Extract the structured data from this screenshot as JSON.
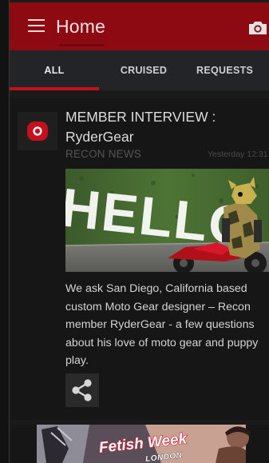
{
  "appbar": {
    "title": "Home",
    "accent_color": "#8e0a12",
    "menu_icon": "hamburger-menu-icon",
    "camera_icon": "camera-icon"
  },
  "tabs": [
    {
      "label": "ALL",
      "selected": true
    },
    {
      "label": "CRUISED",
      "selected": false
    },
    {
      "label": "REQUESTS",
      "selected": false
    }
  ],
  "post": {
    "title": "MEMBER INTERVIEW : RyderGear",
    "source": "RECON NEWS",
    "timestamp": "Yesterday 12:31",
    "image_text": "HELLO",
    "excerpt": "We ask San Diego, California based custom Moto Gear designer – Recon member RyderGear - a few questions about his love of moto gear and puppy play.",
    "share_icon": "share-icon"
  },
  "banner": {
    "title": "Fetish Week",
    "subtitle": "LONDON"
  }
}
